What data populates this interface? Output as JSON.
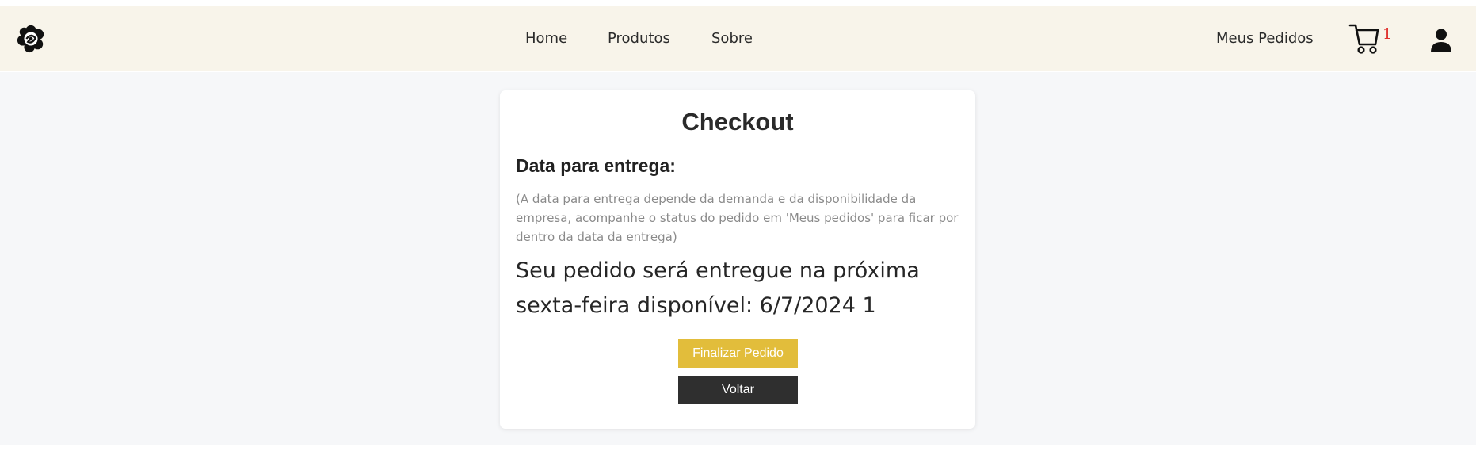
{
  "nav": {
    "links": [
      "Home",
      "Produtos",
      "Sobre"
    ],
    "orders_label": "Meus Pedidos",
    "cart_count": "1"
  },
  "checkout": {
    "title": "Checkout",
    "section_heading": "Data para entrega:",
    "note": "(A data para entrega depende da demanda e da disponibilidade da empresa, acompanhe o status do pedido em 'Meus pedidos' para ficar por dentro da data da entrega)",
    "delivery_message": "Seu pedido será entregue na próxima sexta-feira disponível: 6/7/2024 1",
    "finish_label": "Finalizar Pedido",
    "back_label": "Voltar"
  },
  "colors": {
    "navbar_bg": "#f8f4ea",
    "page_bg": "#f6f7f9",
    "finish_button": "#e2bd3b",
    "back_button": "#2f2f2f",
    "cart_badge": "#e0322f"
  },
  "icons": {
    "logo": "flower-logo-icon",
    "cart": "shopping-cart-icon",
    "user": "user-icon"
  }
}
